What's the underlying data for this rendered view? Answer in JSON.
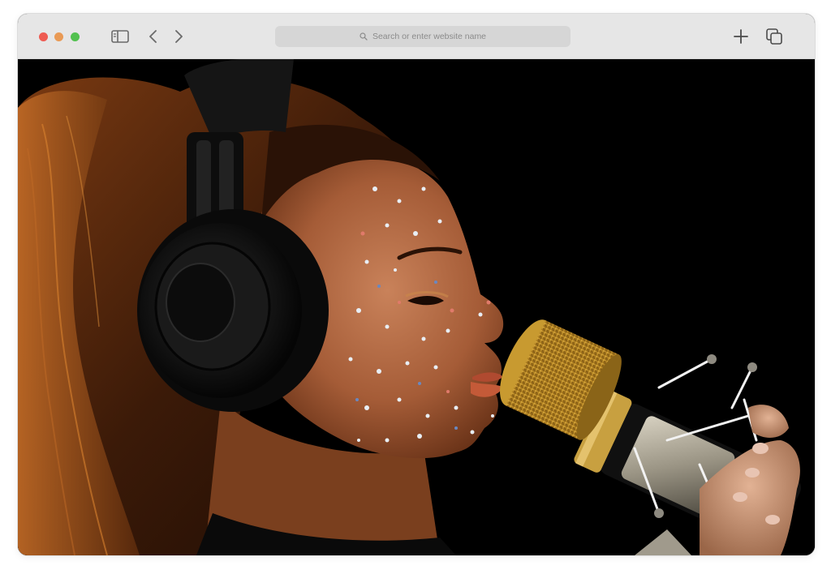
{
  "browser": {
    "address_bar": {
      "placeholder": "Search or enter website name"
    },
    "toolbar_icons": [
      "close-icon",
      "minimize-icon",
      "zoom-icon",
      "sidebar-icon",
      "back-icon",
      "forward-icon",
      "new-tab-icon",
      "tabs-overview-icon"
    ]
  },
  "content": {
    "image_subject": "woman-singing-with-headphones-and-gold-microphone"
  },
  "colors": {
    "traffic_red": "#ee5b52",
    "traffic_yellow": "#e99a55",
    "traffic_green": "#52c14f",
    "toolbar_bg": "#e6e6e6",
    "address_bg": "#d6d6d6",
    "page_bg": "#000000"
  }
}
